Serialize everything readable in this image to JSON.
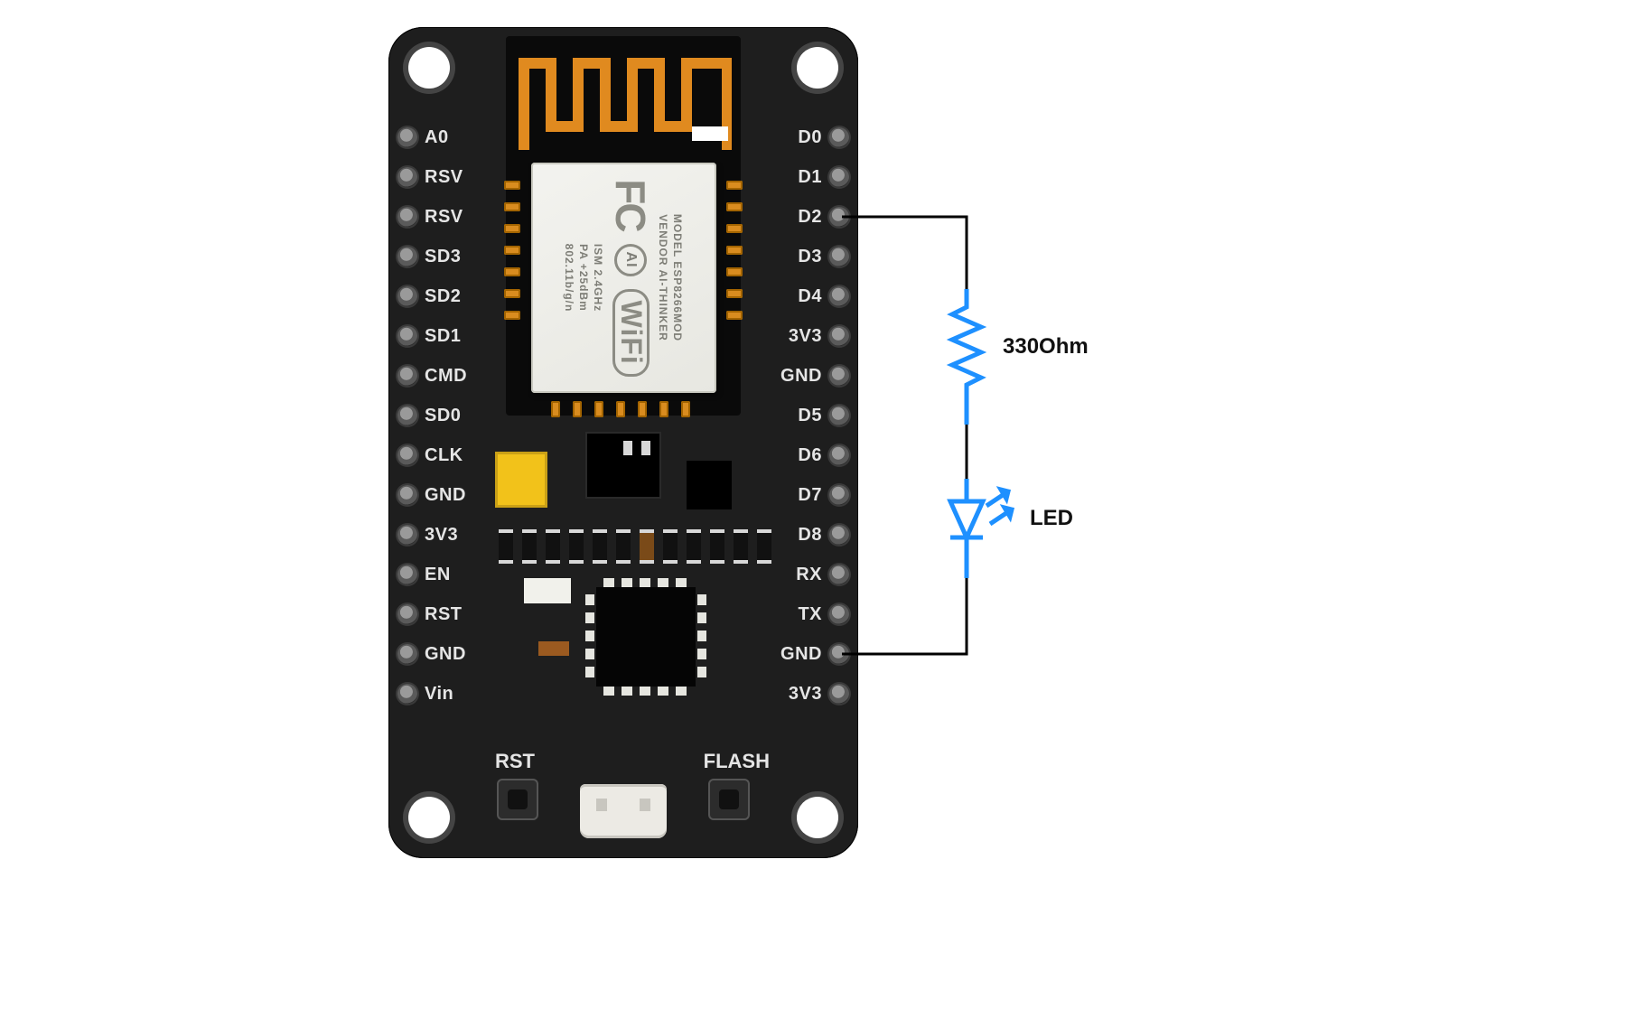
{
  "board": {
    "module": {
      "model_line": "MODEL  ESP8266MOD",
      "vendor_line": "VENDOR  AI-THINKER",
      "ism": "ISM 2.4GHz",
      "pa": "PA +25dBm",
      "std": "802.11b/g/n",
      "wifi_mark": "WiFi",
      "fc_mark": "FC",
      "ai_mark": "AI"
    },
    "pins_left": [
      {
        "label": "A0"
      },
      {
        "label": "RSV"
      },
      {
        "label": "RSV"
      },
      {
        "label": "SD3"
      },
      {
        "label": "SD2"
      },
      {
        "label": "SD1"
      },
      {
        "label": "CMD"
      },
      {
        "label": "SD0"
      },
      {
        "label": "CLK"
      },
      {
        "label": "GND"
      },
      {
        "label": "3V3"
      },
      {
        "label": "EN"
      },
      {
        "label": "RST"
      },
      {
        "label": "GND"
      },
      {
        "label": "Vin"
      }
    ],
    "pins_right": [
      {
        "label": "D0"
      },
      {
        "label": "D1"
      },
      {
        "label": "D2"
      },
      {
        "label": "D3"
      },
      {
        "label": "D4"
      },
      {
        "label": "3V3"
      },
      {
        "label": "GND"
      },
      {
        "label": "D5"
      },
      {
        "label": "D6"
      },
      {
        "label": "D7"
      },
      {
        "label": "D8"
      },
      {
        "label": "RX"
      },
      {
        "label": "TX"
      },
      {
        "label": "GND"
      },
      {
        "label": "3V3"
      }
    ],
    "buttons": {
      "rst": "RST",
      "flash": "FLASH"
    }
  },
  "circuit": {
    "from_pin": "D2",
    "to_pin": "GND",
    "resistor": {
      "value": "330Ohm",
      "color": "#1e90ff"
    },
    "led": {
      "label": "LED",
      "color": "#1e90ff"
    }
  },
  "colors": {
    "board": "#1e1e1e",
    "copper": "#e08a1f",
    "wire": "#000",
    "component": "#1e90ff"
  },
  "chart_data": {
    "type": "diagram",
    "description": "NodeMCU ESP8266 dev board wiring diagram",
    "connections": [
      {
        "from": "D2",
        "through": [
          "330Ohm resistor",
          "LED (anode→cathode)"
        ],
        "to": "GND"
      }
    ],
    "components": [
      {
        "name": "NodeMCU ESP8266MOD (AI-THINKER)",
        "type": "microcontroller"
      },
      {
        "name": "Resistor",
        "value": "330 Ohm"
      },
      {
        "name": "LED"
      }
    ]
  }
}
